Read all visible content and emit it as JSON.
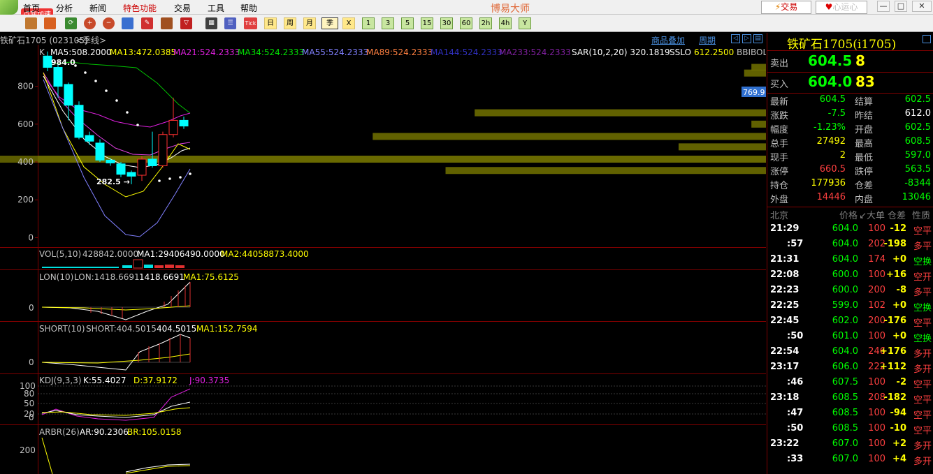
{
  "menu": {
    "items": [
      "首页",
      "分析",
      "新闻",
      "特色功能",
      "交易",
      "工具",
      "帮助"
    ],
    "title": "博易大师",
    "badge": "点我加速",
    "trade_label": "交易",
    "heart_label": "心运心"
  },
  "toolbar": {
    "period_buttons": [
      "日",
      "周",
      "月",
      "季",
      "X",
      "1",
      "3",
      "5",
      "15",
      "30",
      "60",
      "2h",
      "4h",
      "Y"
    ],
    "active_period": "季"
  },
  "chart": {
    "symbol": "铁矿石1705 (023105)",
    "period_label": "<季线>",
    "links": [
      "商品叠加",
      "周期"
    ],
    "main": {
      "k_label": "K",
      "ma5": "MA5:508.2000",
      "ma13": "MA13:472.0385",
      "ma21": "MA21:524.2333",
      "ma34": "MA34:524.2333",
      "ma55": "MA55:524.2333",
      "ma89": "MA89:524.2333",
      "ma144": "MA144:524.2333",
      "ma233": "MA233:524.2333",
      "sar": "SAR(10,2,20) 320.1819",
      "sslo": "SSLO",
      "sslo_val": "612.2500",
      "bbibol": "BBIBOLI",
      "y_ticks": [
        "800",
        "600",
        "400",
        "200",
        "0"
      ],
      "high_mark": "984.0",
      "low_mark": "282.5 →",
      "price_tag": "769.9"
    },
    "vol": {
      "title": "VOL(5,10)",
      "val": "428842.0000",
      "ma1": "MA1:29406490.0000",
      "ma2": "MA2:44058873.4000"
    },
    "lon": {
      "title": "LON(10)",
      "val": "LON:1418.6691",
      "val2": "1418.6691",
      "ma1": "MA1:75.6125",
      "tick": "0"
    },
    "short": {
      "title": "SHORT(10)",
      "val": "SHORT:404.5015",
      "val2": "404.5015",
      "ma1": "MA1:152.7594",
      "tick": "0"
    },
    "kdj": {
      "title": "KDJ(9,3,3)",
      "k": "K:55.4027",
      "d": "D:37.9172",
      "j": "J:90.3735",
      "ticks": [
        "100",
        "80",
        "50",
        "20",
        "0"
      ]
    },
    "arbr": {
      "title": "ARBR(26)",
      "ar": "AR:90.2306",
      "br": "BR:105.0158",
      "tick": "200"
    }
  },
  "chart_data": {
    "type": "candlestick",
    "title": "铁矿石1705 (023105) <季线>",
    "ylim": [
      -50,
      1020
    ],
    "candles": [
      {
        "o": 960,
        "c": 900,
        "h": 984,
        "l": 880
      },
      {
        "o": 900,
        "c": 800,
        "h": 920,
        "l": 740
      },
      {
        "o": 810,
        "c": 700,
        "h": 820,
        "l": 620
      },
      {
        "o": 700,
        "c": 530,
        "h": 720,
        "l": 520
      },
      {
        "o": 540,
        "c": 510,
        "h": 560,
        "l": 490
      },
      {
        "o": 500,
        "c": 410,
        "h": 520,
        "l": 400
      },
      {
        "o": 410,
        "c": 395,
        "h": 420,
        "l": 380
      },
      {
        "o": 390,
        "c": 335,
        "h": 400,
        "l": 320
      },
      {
        "o": 345,
        "c": 325,
        "h": 355,
        "l": 282.5
      },
      {
        "o": 330,
        "c": 415,
        "h": 430,
        "l": 300
      },
      {
        "o": 415,
        "c": 380,
        "h": 560,
        "l": 370
      },
      {
        "o": 380,
        "c": 545,
        "h": 560,
        "l": 370
      },
      {
        "o": 545,
        "c": 620,
        "h": 740,
        "l": 530
      },
      {
        "o": 620,
        "c": 590,
        "h": 640,
        "l": 575
      }
    ],
    "volume_profile": [
      {
        "price": 900,
        "width": 0.02
      },
      {
        "price": 870,
        "width": 0.03
      },
      {
        "price": 660,
        "width": 0.4
      },
      {
        "price": 600,
        "width": 0.02
      },
      {
        "price": 535,
        "width": 0.54
      },
      {
        "price": 480,
        "width": 0.12
      },
      {
        "price": 415,
        "width": 1.0
      },
      {
        "price": 355,
        "width": 0.44
      }
    ]
  },
  "quote": {
    "title": "铁矿石1705(i1705)",
    "sell_label": "卖出",
    "sell_price": "604.5",
    "sell_vol": "8",
    "buy_label": "买入",
    "buy_price": "604.0",
    "buy_vol": "83",
    "stats": [
      [
        "最新",
        "604.5",
        "结算",
        "602.5"
      ],
      [
        "涨跌",
        "-7.5",
        "昨结",
        "612.0"
      ],
      [
        "幅度",
        "-1.23%",
        "开盘",
        "602.5"
      ],
      [
        "总手",
        "27492",
        "最高",
        "608.5"
      ],
      [
        "现手",
        "2",
        "最低",
        "597.0"
      ],
      [
        "涨停",
        "660.5",
        "跌停",
        "563.5"
      ],
      [
        "持仓",
        "177936",
        "仓差",
        "-8344"
      ],
      [
        "外盘",
        "14446",
        "内盘",
        "13046"
      ]
    ],
    "tick_header": [
      "北京",
      "价格",
      "↙大单",
      "仓差",
      "性质"
    ],
    "ticks": [
      [
        "21:29",
        "604.0",
        "100",
        "-12",
        "空平"
      ],
      [
        ":57",
        "604.0",
        "202",
        "-198",
        "多平"
      ],
      [
        "21:31",
        "604.0",
        "174",
        "+0",
        "空换"
      ],
      [
        "22:08",
        "600.0",
        "100",
        "+16",
        "空开"
      ],
      [
        "22:23",
        "600.0",
        "200",
        "-8",
        "多平"
      ],
      [
        "22:25",
        "599.0",
        "102",
        "+0",
        "空换"
      ],
      [
        "22:45",
        "602.0",
        "200",
        "-176",
        "空平"
      ],
      [
        ":50",
        "601.0",
        "100",
        "+0",
        "空换"
      ],
      [
        "22:54",
        "604.0",
        "246",
        "+176",
        "多开"
      ],
      [
        "23:17",
        "606.0",
        "222",
        "+112",
        "多开"
      ],
      [
        ":46",
        "607.5",
        "100",
        "-2",
        "空平"
      ],
      [
        "23:18",
        "608.5",
        "208",
        "-182",
        "空平"
      ],
      [
        ":47",
        "608.5",
        "100",
        "-94",
        "空平"
      ],
      [
        ":50",
        "608.5",
        "100",
        "-10",
        "空平"
      ],
      [
        "23:22",
        "607.0",
        "100",
        "+2",
        "多开"
      ],
      [
        ":33",
        "607.0",
        "100",
        "+4",
        "多开"
      ]
    ]
  }
}
